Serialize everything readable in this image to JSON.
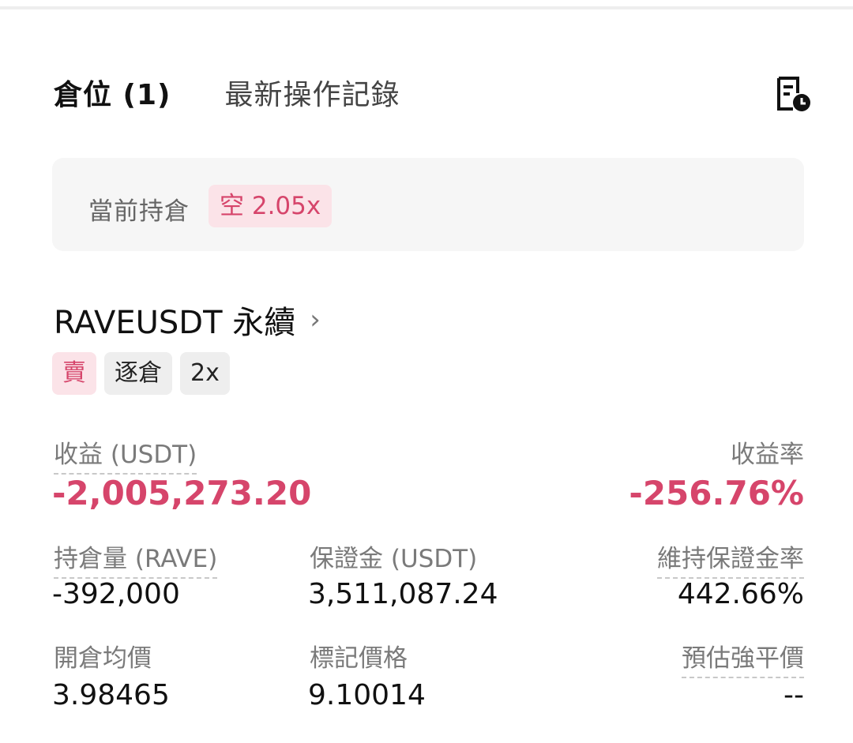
{
  "tabs": {
    "positions": "倉位 (1)",
    "history": "最新操作記錄"
  },
  "history_icon": "document-clock-icon",
  "summary": {
    "label": "當前持倉",
    "chip": "空 2.05x"
  },
  "position": {
    "symbol": "RAVEUSDT 永續",
    "chevron": "›",
    "tags": [
      "賣",
      "逐倉",
      "2x"
    ]
  },
  "metrics": {
    "pnl_label": "收益 (USDT)",
    "pnl_value": "-2,005,273.20",
    "roi_label": "收益率",
    "roi_value": "-256.76%",
    "size_label": "持倉量 (RAVE)",
    "size_value": "-392,000",
    "margin_label": "保證金 (USDT)",
    "margin_value": "3,511,087.24",
    "mmr_label": "維持保證金率",
    "mmr_value": "442.66%",
    "entry_label": "開倉均價",
    "entry_value": "3.98465",
    "mark_label": "標記價格",
    "mark_value": "9.10014",
    "liq_label": "預估強平價",
    "liq_value": "--"
  },
  "colors": {
    "negative": "#d6456b",
    "chip_bg": "#fbe3e8"
  }
}
